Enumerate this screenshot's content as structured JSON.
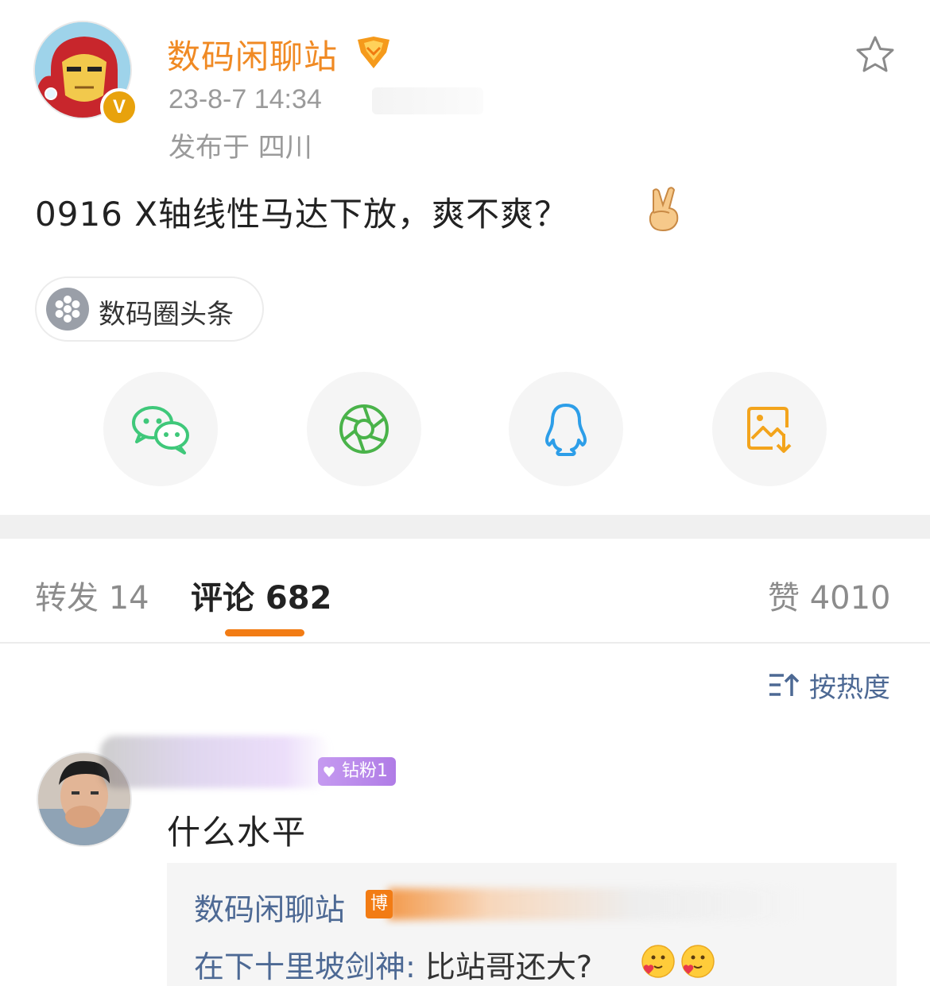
{
  "post": {
    "author": "数码闲聊站",
    "verified_mark": "V",
    "time": "23-8-7 14:34",
    "location": "发布于 四川",
    "content": "0916 X轴线性马达下放，爽不爽？",
    "emoji": "victory-hand",
    "topic": "数码圈头条"
  },
  "share": [
    {
      "name": "wechat",
      "color": "#3fc87a"
    },
    {
      "name": "moments",
      "color": "#4ab34a"
    },
    {
      "name": "qq",
      "color": "#2d9ee8"
    },
    {
      "name": "save-image",
      "color": "#f3a41c"
    }
  ],
  "tabs": {
    "repost": "转发 14",
    "comment": "评论 682",
    "like": "赞 4010"
  },
  "sort": {
    "label": "按热度"
  },
  "comment": {
    "fan_badge": "钻粉1",
    "text": "什么水平",
    "reply": {
      "author": "数码闲聊站",
      "author_badge": "博",
      "who": "在下十里坡剑神",
      "sep": ":",
      "msg": " 比站哥还大?"
    }
  },
  "colors": {
    "accent_orange": "#f27c14",
    "link_blue": "#4d6994",
    "author_orange": "#f08a24"
  }
}
